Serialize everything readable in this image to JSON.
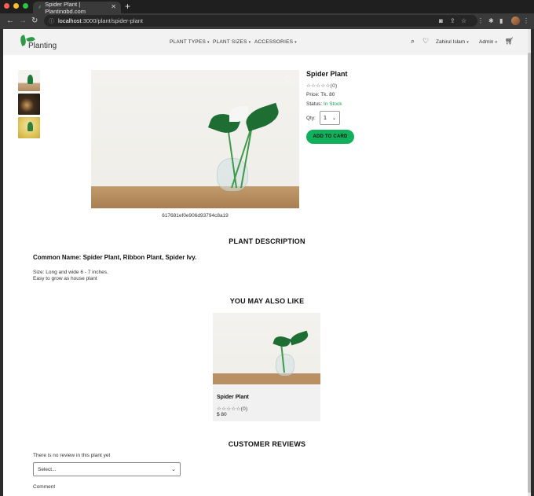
{
  "browser": {
    "tab_title": "Spider Plant | Plantingbd.com",
    "tab_favicon": "plant-favicon",
    "url_host": "localhost",
    "url_path": ":3000/plant/spider-plant"
  },
  "header": {
    "logo_text": "Planting",
    "nav": [
      {
        "label": "PLANT TYPES"
      },
      {
        "label": "PLANT SIZES"
      },
      {
        "label": "ACCESSORIES"
      }
    ],
    "user_label": "Zahirul Islam",
    "admin_label": "Admin"
  },
  "product": {
    "title": "Spider Plant",
    "rating_count": "(0)",
    "price_line": "Price: Tk. 80",
    "status_label": "Status:",
    "status_value": "In Stock",
    "qty_label": "Qty:",
    "qty_value": "1",
    "add_button": "ADD TO CARD",
    "image_id": "617681ef0e906d93794c8a19"
  },
  "description": {
    "heading": "PLANT DESCRIPTION",
    "common_name": "Common Name: Spider Plant, Ribbon Plant, Spider Ivy.",
    "size_line": "Size: Long and wide 6 - 7 inches.",
    "easy_line": "Easy to grow as house plant"
  },
  "related": {
    "heading": "YOU MAY ALSO LIKE",
    "items": [
      {
        "name": "Spider Plant",
        "rating_count": "(0)",
        "price": "$ 80"
      }
    ]
  },
  "reviews": {
    "heading": "CUSTOMER REVIEWS",
    "empty_text": "There is no review in this plant yet",
    "select_placeholder": "Select...",
    "comment_label": "Comment"
  },
  "colors": {
    "accent": "#11b05a",
    "in_stock": "#1f9d55",
    "header_bg": "#f2f2f2"
  }
}
